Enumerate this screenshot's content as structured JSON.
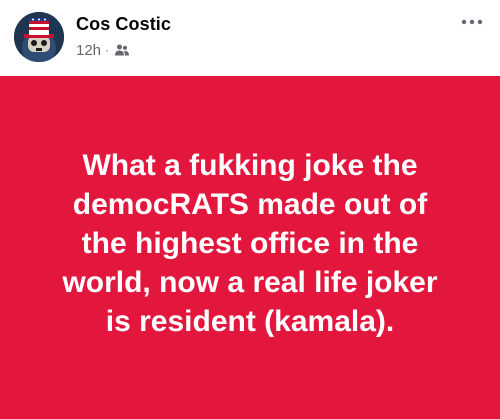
{
  "post": {
    "author": "Cos Costic",
    "time": "12h",
    "separator": "·",
    "audience_icon": "friends-icon",
    "more_icon": "more-options-icon",
    "text": "What a fukking joke the\ndemocRATS made out of\nthe highest office in the\nworld, now a real life joker\nis resident (kamala).",
    "background_color": "#e3173e",
    "text_color": "#ffffff"
  }
}
